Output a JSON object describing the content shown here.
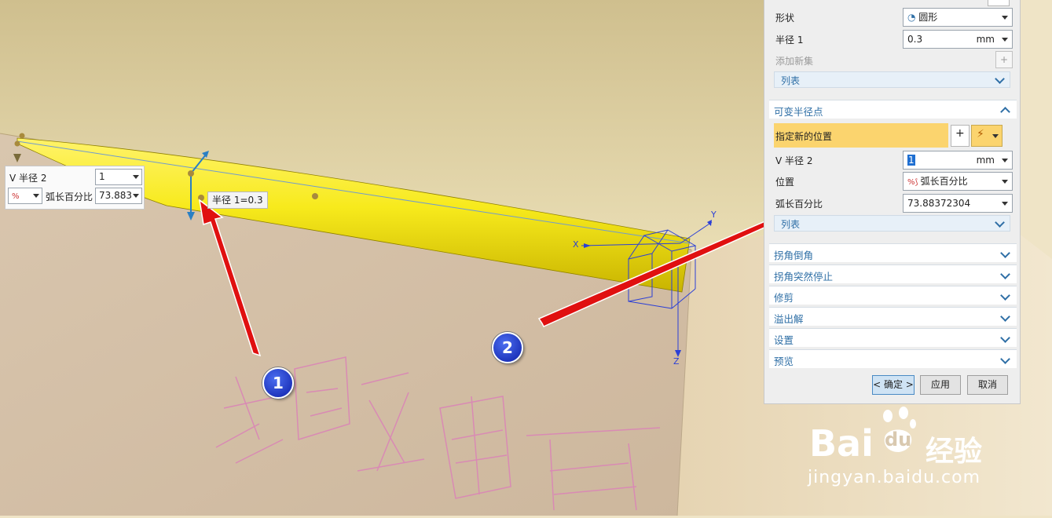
{
  "float_widget": {
    "v_radius_label": "V 半径 2",
    "v_radius_value": "1",
    "arc_percent_label": "弧长百分比",
    "arc_percent_value": "73.883"
  },
  "viewport": {
    "radius_tooltip": "半径 1=0.3",
    "axis_x": "X",
    "axis_y": "Y",
    "axis_z": "Z",
    "callout_1": "1",
    "callout_2": "2",
    "model_text": "比亚迪宣百"
  },
  "panel": {
    "shape_label": "形状",
    "shape_value": "圆形",
    "radius1_label": "半径 1",
    "radius1_value": "0.3",
    "radius1_unit": "mm",
    "add_new_set_label": "添加新集",
    "list_label": "列表",
    "variable_radius_section": "可变半径点",
    "specify_location_label": "指定新的位置",
    "v_radius2_label": "V 半径 2",
    "v_radius2_value": "1",
    "v_radius2_unit": "mm",
    "position_label": "位置",
    "position_value": "弧长百分比",
    "arc_percent_label": "弧长百分比",
    "arc_percent_value": "73.88372304",
    "list2_label": "列表",
    "sections": [
      "拐角倒角",
      "拐角突然停止",
      "修剪",
      "溢出解",
      "设置",
      "预览"
    ],
    "ok_button": "< 确定 >",
    "apply_button": "应用",
    "cancel_button": "取消"
  },
  "watermark": {
    "brand": "Bai",
    "brand2": "du",
    "brand_cn": "经验",
    "url": "jingyan.baidu.com"
  },
  "colors": {
    "solid_yellow": "#f7ea1c",
    "section_blue": "#2f6fa6",
    "highlight": "#fbd46e",
    "arrow_red": "#e01010"
  }
}
